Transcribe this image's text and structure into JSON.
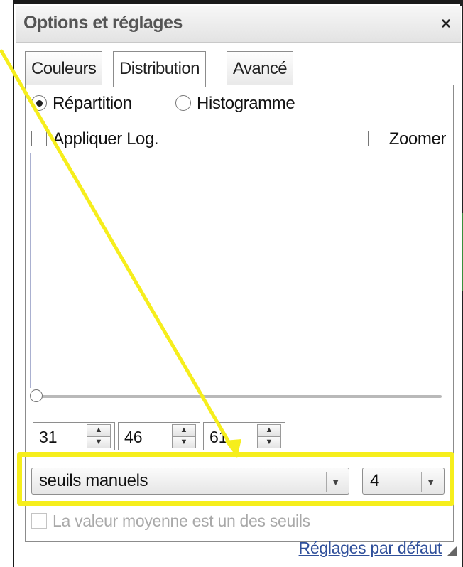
{
  "dialog": {
    "title": "Options et réglages",
    "close_icon": "×"
  },
  "tabs": [
    {
      "label": "Couleurs",
      "active": false
    },
    {
      "label": "Distribution",
      "active": true
    },
    {
      "label": "Avancé",
      "active": false
    }
  ],
  "distribution": {
    "radio_options": [
      {
        "label": "Répartition",
        "checked": true
      },
      {
        "label": "Histogramme",
        "checked": false
      }
    ],
    "log_checkbox": {
      "label": "Appliquer Log.",
      "checked": false
    },
    "zoom_checkbox": {
      "label": "Zoomer",
      "checked": false
    },
    "thresholds": [
      "31",
      "46",
      "61"
    ],
    "stepper_up_icon": "▲",
    "stepper_down_icon": "▼",
    "method_select": {
      "value": "seuils manuels"
    },
    "count_select": {
      "value": "4"
    },
    "select_arrow_icon": "▼",
    "average_checkbox": {
      "label": "La valeur moyenne est un des seuils",
      "checked": false,
      "disabled": true
    }
  },
  "footer": {
    "reset_link": "Réglages par défaut"
  },
  "annotation": {
    "color": "#f6ee1c"
  }
}
